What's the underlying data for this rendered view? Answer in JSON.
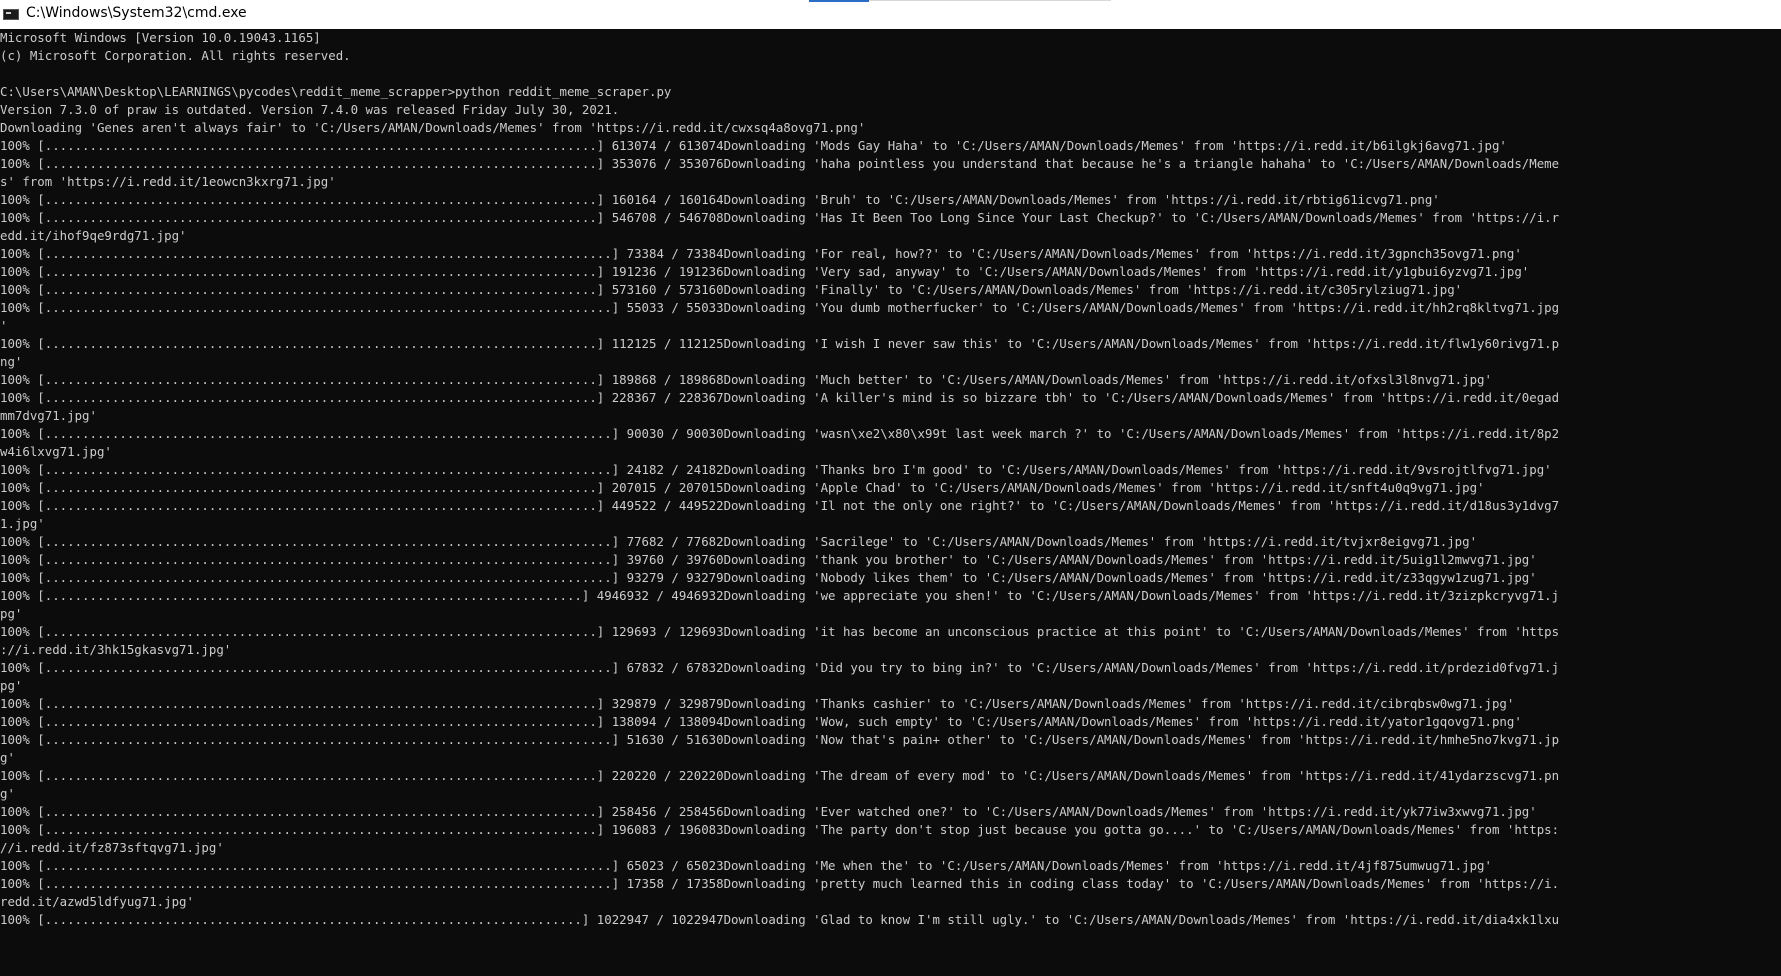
{
  "window": {
    "title": "C:\\Windows\\System32\\cmd.exe"
  },
  "console": {
    "lines": [
      "Microsoft Windows [Version 10.0.19043.1165]",
      "(c) Microsoft Corporation. All rights reserved.",
      "",
      "C:\\Users\\AMAN\\Desktop\\LEARNINGS\\pycodes\\reddit_meme_scrapper>python reddit_meme_scraper.py",
      "Version 7.3.0 of praw is outdated. Version 7.4.0 was released Friday July 30, 2021.",
      "Downloading 'Genes aren't always fair' to 'C:/Users/AMAN/Downloads/Memes' from 'https://i.redd.it/cwxsq4a8ovg71.png'",
      "100% [..........................................................................] 613074 / 613074Downloading 'Mods Gay Haha' to 'C:/Users/AMAN/Downloads/Memes' from 'https://i.redd.it/b6ilgkj6avg71.jpg'",
      "100% [..........................................................................] 353076 / 353076Downloading 'haha pointless you understand that because he's a triangle hahaha' to 'C:/Users/AMAN/Downloads/Meme",
      "s' from 'https://i.redd.it/1eowcn3kxrg71.jpg'",
      "100% [..........................................................................] 160164 / 160164Downloading 'Bruh' to 'C:/Users/AMAN/Downloads/Memes' from 'https://i.redd.it/rbtig61icvg71.png'",
      "100% [..........................................................................] 546708 / 546708Downloading 'Has It Been Too Long Since Your Last Checkup?' to 'C:/Users/AMAN/Downloads/Memes' from 'https://i.r",
      "edd.it/ihof9qe9rdg71.jpg'",
      "100% [............................................................................] 73384 / 73384Downloading 'For real, how??' to 'C:/Users/AMAN/Downloads/Memes' from 'https://i.redd.it/3gpnch35ovg71.png'",
      "100% [..........................................................................] 191236 / 191236Downloading 'Very sad, anyway' to 'C:/Users/AMAN/Downloads/Memes' from 'https://i.redd.it/y1gbui6yzvg71.jpg'",
      "100% [..........................................................................] 573160 / 573160Downloading 'Finally' to 'C:/Users/AMAN/Downloads/Memes' from 'https://i.redd.it/c305rylziug71.jpg'",
      "100% [............................................................................] 55033 / 55033Downloading 'You dumb motherfucker' to 'C:/Users/AMAN/Downloads/Memes' from 'https://i.redd.it/hh2rq8kltvg71.jpg",
      "'",
      "100% [..........................................................................] 112125 / 112125Downloading 'I wish I never saw this' to 'C:/Users/AMAN/Downloads/Memes' from 'https://i.redd.it/flw1y60rivg71.p",
      "ng'",
      "100% [..........................................................................] 189868 / 189868Downloading 'Much better' to 'C:/Users/AMAN/Downloads/Memes' from 'https://i.redd.it/ofxsl3l8nvg71.jpg'",
      "100% [..........................................................................] 228367 / 228367Downloading 'A killer's mind is so bizzare tbh' to 'C:/Users/AMAN/Downloads/Memes' from 'https://i.redd.it/0egad",
      "mm7dvg71.jpg'",
      "100% [............................................................................] 90030 / 90030Downloading 'wasn\\xe2\\x80\\x99t last week march ?' to 'C:/Users/AMAN/Downloads/Memes' from 'https://i.redd.it/8p2",
      "w4i6lxvg71.jpg'",
      "100% [............................................................................] 24182 / 24182Downloading 'Thanks bro I'm good' to 'C:/Users/AMAN/Downloads/Memes' from 'https://i.redd.it/9vsrojtlfvg71.jpg'",
      "100% [..........................................................................] 207015 / 207015Downloading 'Apple Chad' to 'C:/Users/AMAN/Downloads/Memes' from 'https://i.redd.it/snft4u0q9vg71.jpg'",
      "100% [..........................................................................] 449522 / 449522Downloading 'Il not the only one right?' to 'C:/Users/AMAN/Downloads/Memes' from 'https://i.redd.it/d18us3y1dvg7",
      "1.jpg'",
      "100% [............................................................................] 77682 / 77682Downloading 'Sacrilege' to 'C:/Users/AMAN/Downloads/Memes' from 'https://i.redd.it/tvjxr8eigvg71.jpg'",
      "100% [............................................................................] 39760 / 39760Downloading 'thank you brother' to 'C:/Users/AMAN/Downloads/Memes' from 'https://i.redd.it/5uig1l2mwvg71.jpg'",
      "100% [............................................................................] 93279 / 93279Downloading 'Nobody likes them' to 'C:/Users/AMAN/Downloads/Memes' from 'https://i.redd.it/z33qgyw1zug71.jpg'",
      "100% [........................................................................] 4946932 / 4946932Downloading 'we appreciate you shen!' to 'C:/Users/AMAN/Downloads/Memes' from 'https://i.redd.it/3zizpkcryvg71.j",
      "pg'",
      "100% [..........................................................................] 129693 / 129693Downloading 'it has become an unconscious practice at this point' to 'C:/Users/AMAN/Downloads/Memes' from 'https",
      "://i.redd.it/3hk15gkasvg71.jpg'",
      "100% [............................................................................] 67832 / 67832Downloading 'Did you try to bing in?' to 'C:/Users/AMAN/Downloads/Memes' from 'https://i.redd.it/prdezid0fvg71.j",
      "pg'",
      "100% [..........................................................................] 329879 / 329879Downloading 'Thanks cashier' to 'C:/Users/AMAN/Downloads/Memes' from 'https://i.redd.it/cibrqbsw0wg71.jpg'",
      "100% [..........................................................................] 138094 / 138094Downloading 'Wow, such empty' to 'C:/Users/AMAN/Downloads/Memes' from 'https://i.redd.it/yator1gqovg71.png'",
      "100% [............................................................................] 51630 / 51630Downloading 'Now that's pain+ other' to 'C:/Users/AMAN/Downloads/Memes' from 'https://i.redd.it/hmhe5no7kvg71.jp",
      "g'",
      "100% [..........................................................................] 220220 / 220220Downloading 'The dream of every mod' to 'C:/Users/AMAN/Downloads/Memes' from 'https://i.redd.it/41ydarzscvg71.pn",
      "g'",
      "100% [..........................................................................] 258456 / 258456Downloading 'Ever watched one?' to 'C:/Users/AMAN/Downloads/Memes' from 'https://i.redd.it/yk77iw3xwvg71.jpg'",
      "100% [..........................................................................] 196083 / 196083Downloading 'The party don't stop just because you gotta go....' to 'C:/Users/AMAN/Downloads/Memes' from 'https:",
      "//i.redd.it/fz873sftqvg71.jpg'",
      "100% [............................................................................] 65023 / 65023Downloading 'Me when the' to 'C:/Users/AMAN/Downloads/Memes' from 'https://i.redd.it/4jf875umwug71.jpg'",
      "100% [............................................................................] 17358 / 17358Downloading 'pretty much learned this in coding class today' to 'C:/Users/AMAN/Downloads/Memes' from 'https://i.",
      "redd.it/azwd5ldfyug71.jpg'",
      "100% [........................................................................] 1022947 / 1022947Downloading 'Glad to know I'm still ugly.' to 'C:/Users/AMAN/Downloads/Memes' from 'https://i.redd.it/dia4xk1lxu"
    ]
  }
}
